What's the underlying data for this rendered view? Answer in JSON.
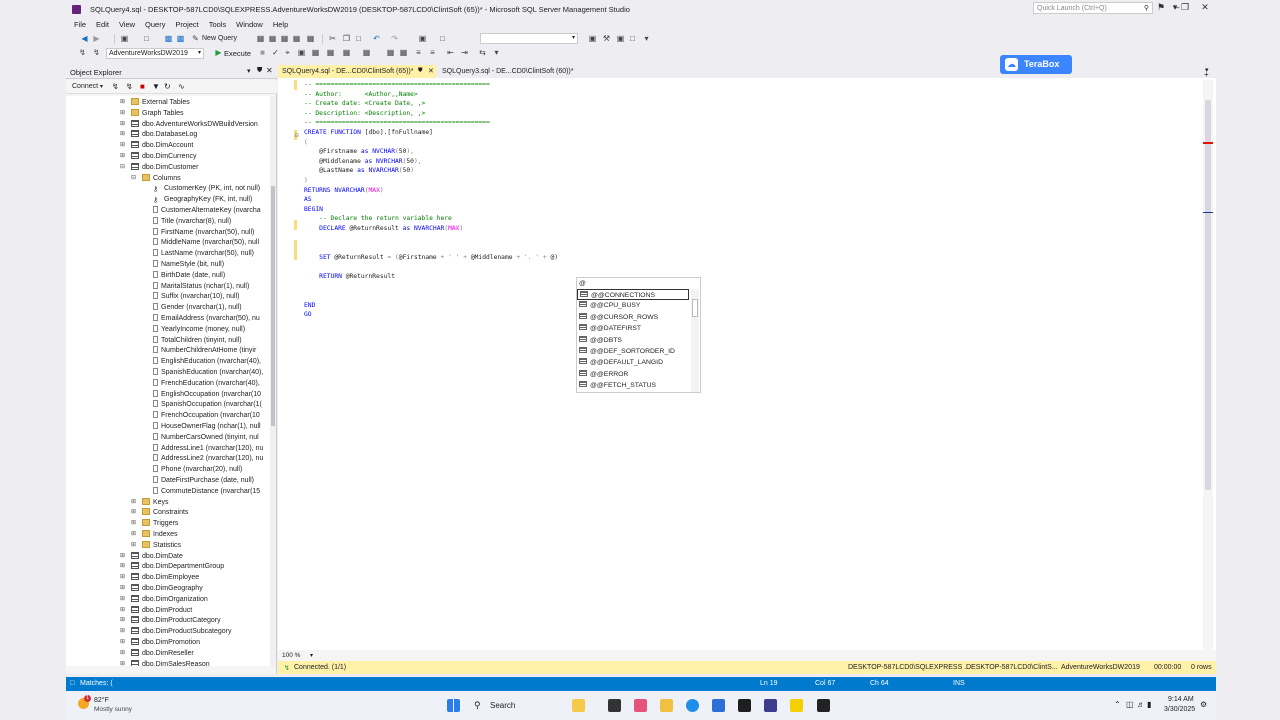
{
  "window": {
    "title": "SQLQuery4.sql - DESKTOP-587LCD0\\SQLEXPRESS.AdventureWorksDW2019 (DESKTOP-587LCD0\\ClintSoft (65))* - Microsoft SQL Server Management Studio",
    "quick_launch_placeholder": "Quick Launch (Ctrl+Q)"
  },
  "menu": [
    "File",
    "Edit",
    "View",
    "Query",
    "Project",
    "Tools",
    "Window",
    "Help"
  ],
  "toolbar": {
    "new_query": "New Query",
    "database": "AdventureWorksDW2019",
    "execute": "Execute"
  },
  "object_explorer": {
    "title": "Object Explorer",
    "connect": "Connect",
    "tree": [
      {
        "label": "External Tables",
        "icon": "folder"
      },
      {
        "label": "Graph Tables",
        "icon": "folder"
      },
      {
        "label": "dbo.AdventureWorksDWBuildVersion",
        "icon": "table"
      },
      {
        "label": "dbo.DatabaseLog",
        "icon": "table"
      },
      {
        "label": "dbo.DimAccount",
        "icon": "table"
      },
      {
        "label": "dbo.DimCurrency",
        "icon": "table"
      },
      {
        "label": "dbo.DimCustomer",
        "icon": "table"
      },
      {
        "label": "Columns",
        "icon": "folder"
      },
      {
        "label": "CustomerKey (PK, int, not null)",
        "icon": "key"
      },
      {
        "label": "GeographyKey (FK, int, null)",
        "icon": "key"
      },
      {
        "label": "CustomerAlternateKey (nvarcha",
        "icon": "col"
      },
      {
        "label": "Title (nvarchar(8), null)",
        "icon": "col"
      },
      {
        "label": "FirstName (nvarchar(50), null)",
        "icon": "col"
      },
      {
        "label": "MiddleName (nvarchar(50), null",
        "icon": "col"
      },
      {
        "label": "LastName (nvarchar(50), null)",
        "icon": "col"
      },
      {
        "label": "NameStyle (bit, null)",
        "icon": "col"
      },
      {
        "label": "BirthDate (date, null)",
        "icon": "col"
      },
      {
        "label": "MaritalStatus (nchar(1), null)",
        "icon": "col"
      },
      {
        "label": "Suffix (nvarchar(10), null)",
        "icon": "col"
      },
      {
        "label": "Gender (nvarchar(1), null)",
        "icon": "col"
      },
      {
        "label": "EmailAddress (nvarchar(50), nu",
        "icon": "col"
      },
      {
        "label": "YearlyIncome (money, null)",
        "icon": "col"
      },
      {
        "label": "TotalChildren (tinyint, null)",
        "icon": "col"
      },
      {
        "label": "NumberChildrenAtHome (tinyir",
        "icon": "col"
      },
      {
        "label": "EnglishEducation (nvarchar(40),",
        "icon": "col"
      },
      {
        "label": "SpanishEducation (nvarchar(40),",
        "icon": "col"
      },
      {
        "label": "FrenchEducation (nvarchar(40),",
        "icon": "col"
      },
      {
        "label": "EnglishOccupation (nvarchar(10",
        "icon": "col"
      },
      {
        "label": "SpanishOccupation (nvarchar(1(",
        "icon": "col"
      },
      {
        "label": "FrenchOccupation (nvarchar(10",
        "icon": "col"
      },
      {
        "label": "HouseOwnerFlag (nchar(1), null",
        "icon": "col"
      },
      {
        "label": "NumberCarsOwned (tinyint, nul",
        "icon": "col"
      },
      {
        "label": "AddressLine1 (nvarchar(120), nu",
        "icon": "col"
      },
      {
        "label": "AddressLine2 (nvarchar(120), nu",
        "icon": "col"
      },
      {
        "label": "Phone (nvarchar(20), null)",
        "icon": "col"
      },
      {
        "label": "DateFirstPurchase (date, null)",
        "icon": "col"
      },
      {
        "label": "CommuteDistance (nvarchar(15",
        "icon": "col"
      },
      {
        "label": "Keys",
        "icon": "folder"
      },
      {
        "label": "Constraints",
        "icon": "folder"
      },
      {
        "label": "Triggers",
        "icon": "folder"
      },
      {
        "label": "Indexes",
        "icon": "folder"
      },
      {
        "label": "Statistics",
        "icon": "folder"
      },
      {
        "label": "dbo.DimDate",
        "icon": "table"
      },
      {
        "label": "dbo.DimDepartmentGroup",
        "icon": "table"
      },
      {
        "label": "dbo.DimEmployee",
        "icon": "table"
      },
      {
        "label": "dbo.DimGeography",
        "icon": "table"
      },
      {
        "label": "dbo.DimOrganization",
        "icon": "table"
      },
      {
        "label": "dbo.DimProduct",
        "icon": "table"
      },
      {
        "label": "dbo.DimProductCategory",
        "icon": "table"
      },
      {
        "label": "dbo.DimProductSubcategory",
        "icon": "table"
      },
      {
        "label": "dbo.DimPromotion",
        "icon": "table"
      },
      {
        "label": "dbo.DimReseller",
        "icon": "table"
      },
      {
        "label": "dbo.DimSalesReason",
        "icon": "table"
      }
    ]
  },
  "tabs": [
    {
      "label": "SQLQuery4.sql - DE...CD0\\ClintSoft (65))*"
    },
    {
      "label": "SQLQuery3.sql - DE...CD0\\ClintSoft (60))*"
    }
  ],
  "code_lines": [
    [
      [
        "cm",
        "-- =============================================="
      ]
    ],
    [
      [
        "cm",
        "-- Author:      <Author,,Name>"
      ]
    ],
    [
      [
        "cm",
        "-- Create date: <Create Date, ,>"
      ]
    ],
    [
      [
        "cm",
        "-- Description: <Description, ,>"
      ]
    ],
    [
      [
        "cm",
        "-- =============================================="
      ]
    ],
    [
      [
        "kw",
        "CREATE FUNCTION "
      ],
      [
        "bl",
        "[dbo].[fnFullname]"
      ]
    ],
    [
      [
        "gr",
        "("
      ]
    ],
    [
      [
        "bl",
        "    @Firstname "
      ],
      [
        "kw",
        "as "
      ],
      [
        "ty",
        "NVCHAR"
      ],
      [
        "gr",
        "("
      ],
      [
        "bl",
        "50"
      ],
      [
        "gr",
        "),"
      ]
    ],
    [
      [
        "bl",
        "    @Middlename "
      ],
      [
        "kw",
        "as "
      ],
      [
        "ty",
        "NVRCHAR"
      ],
      [
        "gr",
        "("
      ],
      [
        "bl",
        "50"
      ],
      [
        "gr",
        "),"
      ]
    ],
    [
      [
        "bl",
        "    @LastName "
      ],
      [
        "kw",
        "as "
      ],
      [
        "ty",
        "NVARCHAR"
      ],
      [
        "gr",
        "("
      ],
      [
        "bl",
        "50"
      ],
      [
        "gr",
        ")"
      ]
    ],
    [
      [
        "gr",
        ")"
      ]
    ],
    [
      [
        "kw",
        "RETURNS "
      ],
      [
        "ty",
        "NVARCHAR"
      ],
      [
        "gr",
        "("
      ],
      [
        "mg",
        "MAX"
      ],
      [
        "gr",
        ")"
      ]
    ],
    [
      [
        "kw",
        "AS"
      ]
    ],
    [
      [
        "kw",
        "BEGIN"
      ]
    ],
    [
      [
        "cm",
        "    -- Declare the return variable here"
      ]
    ],
    [
      [
        "kw",
        "    DECLARE "
      ],
      [
        "bl",
        "@ReturnResult "
      ],
      [
        "kw",
        "as "
      ],
      [
        "ty",
        "NVARCHAR"
      ],
      [
        "gr",
        "("
      ],
      [
        "mg",
        "MAX"
      ],
      [
        "gr",
        ")"
      ]
    ],
    [
      [
        "bl",
        ""
      ]
    ],
    [
      [
        "bl",
        ""
      ]
    ],
    [
      [
        "kw",
        "    SET "
      ],
      [
        "bl",
        "@ReturnResult "
      ],
      [
        "gr",
        "= ("
      ],
      [
        "bl",
        "@Firstname "
      ],
      [
        "gr",
        "+ ' ' + "
      ],
      [
        "bl",
        "@Middlename "
      ],
      [
        "gr",
        "+ '. ' + "
      ],
      [
        "bl",
        "@)"
      ]
    ],
    [
      [
        "bl",
        ""
      ]
    ],
    [
      [
        "kw",
        "    RETURN "
      ],
      [
        "bl",
        "@ReturnResult"
      ]
    ],
    [
      [
        "bl",
        ""
      ]
    ],
    [
      [
        "bl",
        ""
      ]
    ],
    [
      [
        "kw",
        "END"
      ]
    ],
    [
      [
        "kw",
        "GO"
      ]
    ]
  ],
  "autocomplete": {
    "typed": "@",
    "items": [
      "@@CONNECTIONS",
      "@@CPU_BUSY",
      "@@CURSOR_ROWS",
      "@@DATEFIRST",
      "@@DBTS",
      "@@DEF_SORTORDER_ID",
      "@@DEFAULT_LANGID",
      "@@ERROR",
      "@@FETCH_STATUS"
    ],
    "selected_index": 0
  },
  "editor_zoom": "100 %",
  "query_status": {
    "connected": "Connected. (1/1)",
    "server": "DESKTOP-587LCD0\\SQLEXPRESS ...",
    "user": "DESKTOP-587LCD0\\ClintS...",
    "database": "AdventureWorksDW2019",
    "elapsed": "00:00:00",
    "rows": "0 rows"
  },
  "statusbar": {
    "find": "Matches: (",
    "line": "Ln 19",
    "col": "Col 67",
    "ch": "Ch 64",
    "mode": "INS"
  },
  "terabox": "TeraBox",
  "taskbar": {
    "weather_temp": "82°F",
    "weather_desc": "Mostly sunny",
    "search": "Search",
    "time": "9:14 AM",
    "date": "3/30/2025",
    "notif_count": "1"
  },
  "colors": {
    "statusbar": "#007acc",
    "tab_active": "#fff1a8",
    "accent": "#68217a"
  }
}
